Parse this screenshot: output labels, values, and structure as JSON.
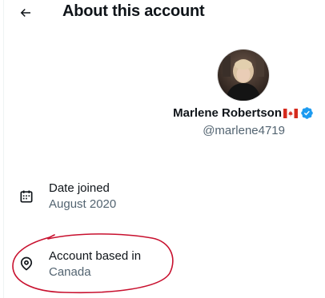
{
  "header": {
    "title": "About this account",
    "back_icon": "arrow-left-icon"
  },
  "profile": {
    "display_name": "Marlene Robertson",
    "flag_icon": "canada-flag-icon",
    "verified_icon": "verified-badge-icon",
    "handle": "@marlene4719"
  },
  "details": [
    {
      "icon": "calendar-icon",
      "label": "Date joined",
      "value": "August 2020"
    },
    {
      "icon": "location-pin-icon",
      "label": "Account based in",
      "value": "Canada"
    }
  ],
  "colors": {
    "text_primary": "#0f1419",
    "text_secondary": "#536471",
    "verified_blue": "#1d9bf0",
    "annotation_red": "#c8102e"
  }
}
